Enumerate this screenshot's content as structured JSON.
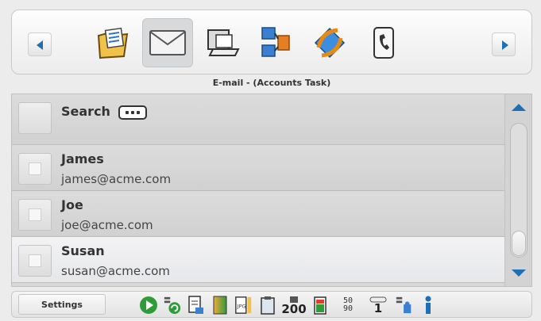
{
  "window": {
    "caption": "E-mail - (Accounts Task)"
  },
  "ribbon": {
    "nav_left": "previous-app",
    "nav_right": "next-app",
    "apps": [
      {
        "name": "folder-tasks-icon",
        "selected": false
      },
      {
        "name": "email-envelope-icon",
        "selected": true
      },
      {
        "name": "laptop-icon",
        "selected": false
      },
      {
        "name": "network-transfer-icon",
        "selected": false
      },
      {
        "name": "sync-diamond-icon",
        "selected": false
      },
      {
        "name": "phone-card-icon",
        "selected": false
      }
    ]
  },
  "list": {
    "search_label": "Search",
    "contacts": [
      {
        "name": "James",
        "email": "james@acme.com",
        "selected": false
      },
      {
        "name": "Joe",
        "email": "joe@acme.com",
        "selected": false
      },
      {
        "name": "Susan",
        "email": "susan@acme.com",
        "selected": true
      }
    ]
  },
  "bottom_bar": {
    "settings_label": "Settings",
    "counter_200": "200",
    "signal_top": "50",
    "signal_bottom": "90",
    "count_one": "1"
  },
  "colors": {
    "accent": "#1f6fb6"
  }
}
